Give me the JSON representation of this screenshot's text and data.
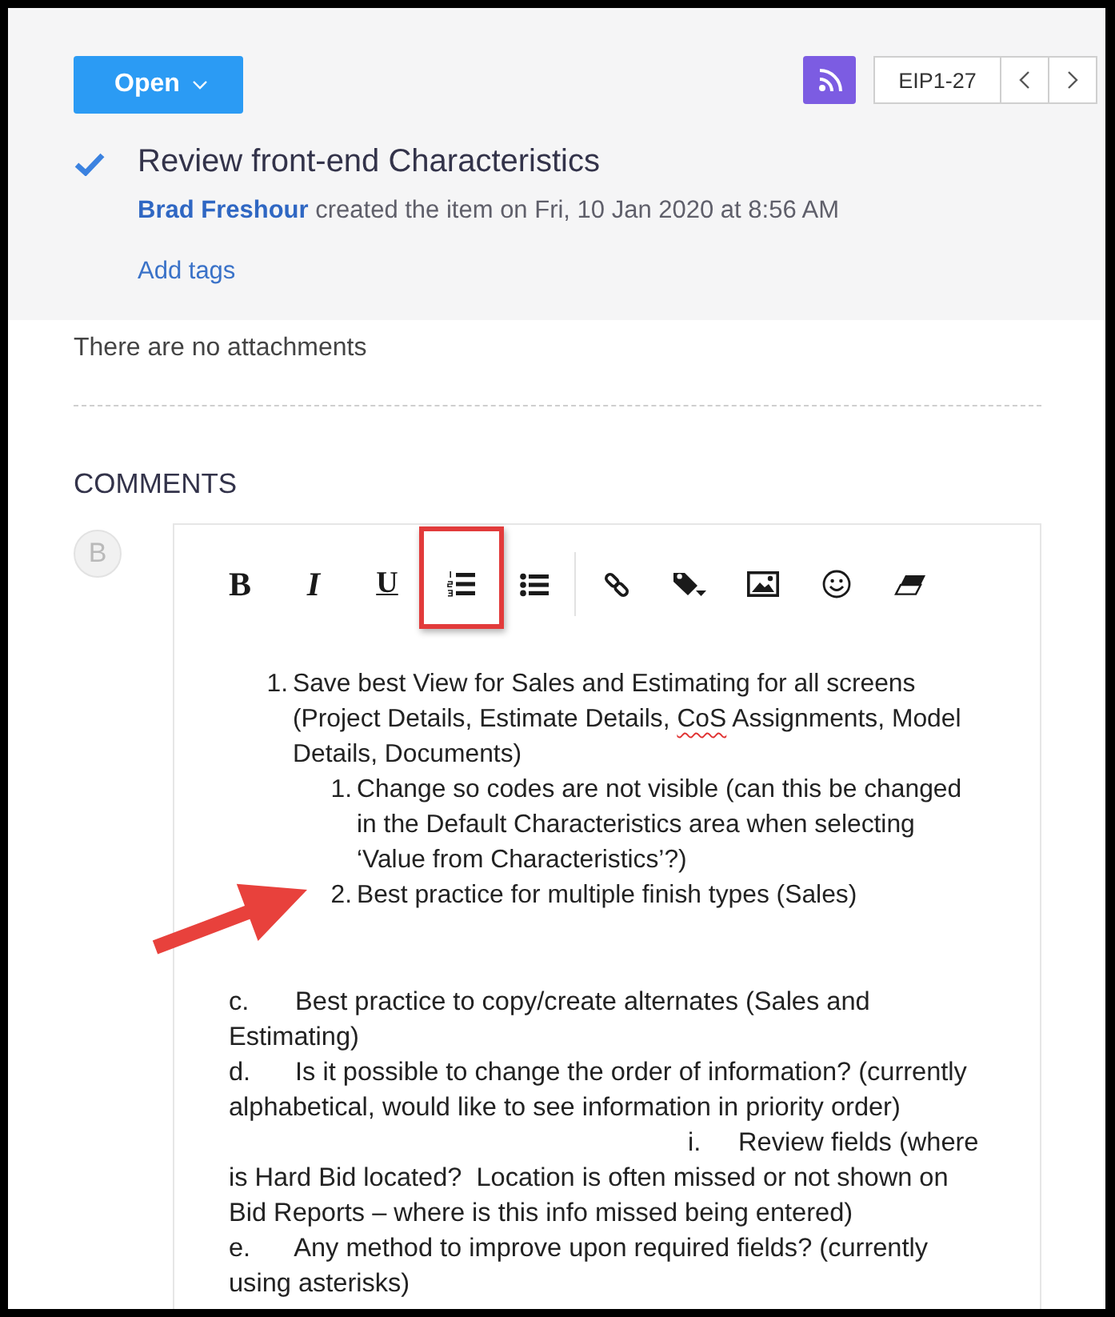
{
  "header": {
    "status_button": "Open",
    "item_id": "EIP1-27",
    "completed": true,
    "title": "Review front-end Characteristics",
    "author": "Brad Freshour",
    "created_text": "created the item on Fri, 10 Jan 2020 at 8:56 AM",
    "add_tags_link": "Add tags"
  },
  "attachments_text": "There are no attachments",
  "comments": {
    "heading": "COMMENTS",
    "avatar_initial": "B",
    "toolbar_groups": [
      [
        {
          "kind": "bold",
          "label": "B",
          "highlighted": false
        },
        {
          "kind": "italic",
          "label": "I",
          "highlighted": false
        },
        {
          "kind": "underline",
          "label": "U",
          "highlighted": false
        },
        {
          "kind": "ordered-list",
          "highlighted": true
        },
        {
          "kind": "bullet-list",
          "highlighted": false
        }
      ],
      [
        {
          "kind": "link",
          "highlighted": false
        },
        {
          "kind": "tag",
          "highlighted": false
        },
        {
          "kind": "image",
          "highlighted": false
        },
        {
          "kind": "emoji",
          "highlighted": false
        },
        {
          "kind": "eraser",
          "highlighted": false
        }
      ]
    ],
    "list": [
      {
        "marker": "1.",
        "pointed_at": false,
        "segments": [
          {
            "text": "Save best View for Sales and Estimating for all screens (Project Details, Estimate Details, ",
            "misspelled": false
          },
          {
            "text": "CoS",
            "misspelled": true
          },
          {
            "text": " Assignments, Model Details, Documents)",
            "misspelled": false
          }
        ],
        "children": [
          {
            "marker": "1.",
            "pointed_at": false,
            "segments": [
              {
                "text": "Change so codes are not visible (can this be changed in the Default Characteristics area when selecting ‘Value from Characteristics’?)",
                "misspelled": false
              }
            ]
          },
          {
            "marker": "2.",
            "pointed_at": true,
            "segments": [
              {
                "text": "Best practice for multiple finish types (Sales)",
                "misspelled": false
              }
            ]
          }
        ]
      }
    ],
    "paragraphs": [
      {
        "kind": "lettered",
        "marker": "c.",
        "text": "Best practice to copy/create alternates (Sales and Estimating)"
      },
      {
        "kind": "lettered",
        "marker": "d.",
        "text": "Is it possible to change the order of information? (currently alphabetical, would like to see information in priority order)"
      },
      {
        "kind": "roman",
        "marker": "i.",
        "text": "Review fields (where is Hard Bid located?  Location is often missed or not shown on Bid Reports – where is this info missed being entered)"
      },
      {
        "kind": "lettered",
        "marker": "e.",
        "text": "Any method to improve upon required fields? (currently using asterisks)"
      }
    ]
  }
}
